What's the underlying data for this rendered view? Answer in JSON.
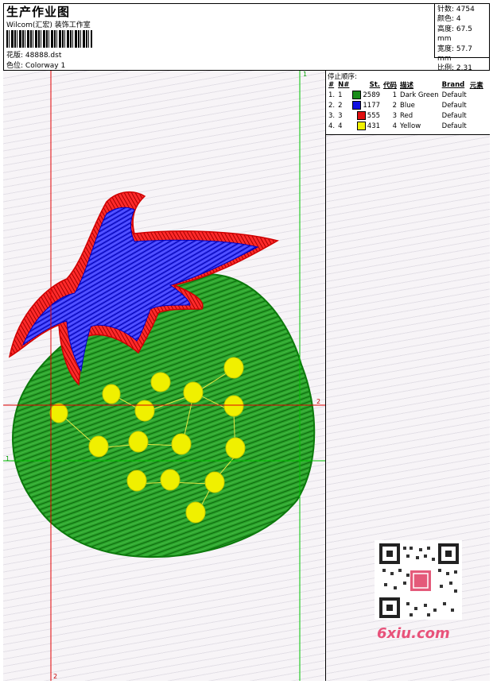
{
  "header": {
    "title": "生产作业图",
    "company": "Wilcom(汇宏) 装饰工作室",
    "design_label": "花版:",
    "design_value": "48888.dst",
    "colorway_label": "色位:",
    "colorway_value": "Colorway 1"
  },
  "stats": {
    "stitches_label": "针数:",
    "stitches_value": "4754",
    "colors_label": "颜色:",
    "colors_value": "4",
    "height_label": "高度:",
    "height_value": "67.5 mm",
    "width_label": "宽度:",
    "width_value": "57.7 mm",
    "scale_label": "比例:",
    "scale_value": "2.31"
  },
  "stop_sequence": {
    "title": "停止顺序:",
    "headers": [
      "#",
      "N#",
      "St.",
      "代码",
      "描述",
      "Brand",
      "元素"
    ],
    "rows": [
      {
        "num": "1.",
        "n": "1",
        "color": "#1a8c1a",
        "st": "2589",
        "code": "1",
        "desc": "Dark Green",
        "brand": "Default"
      },
      {
        "num": "2.",
        "n": "2",
        "color": "#1010e0",
        "st": "1177",
        "code": "2",
        "desc": "Blue",
        "brand": "Default"
      },
      {
        "num": "3.",
        "n": "3",
        "color": "#e01010",
        "st": "555",
        "code": "3",
        "desc": "Red",
        "brand": "Default"
      },
      {
        "num": "4.",
        "n": "4",
        "color": "#f0f000",
        "st": "431",
        "code": "4",
        "desc": "Yellow",
        "brand": "Default"
      }
    ]
  },
  "guides": {
    "green_v_label": "1",
    "green_h_label": "1",
    "red_v_label": "2",
    "red_h_label": "2"
  },
  "watermark": {
    "logo_text": "6xiu.com"
  },
  "colors": {
    "green": "#1a8c1a",
    "blue": "#1010e0",
    "red": "#e01010",
    "yellow": "#f0f000"
  }
}
